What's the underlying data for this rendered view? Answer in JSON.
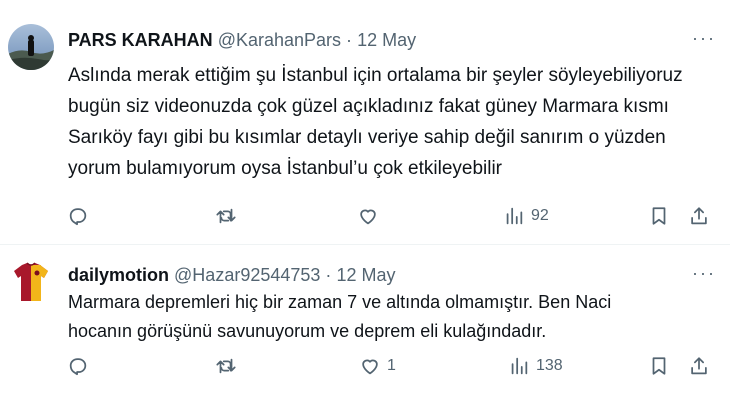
{
  "tweets": [
    {
      "name": "PARS KARAHAN",
      "handle": "@KarahanPars",
      "separator": "·",
      "date": "12 May",
      "more": "···",
      "lines": [
        "Aslında merak  ettiğim şu  İstanbul için ortalama bir şeyler söyleyebiliyoruz",
        "bugün siz videonuzda çok güzel açıkladınız fakat güney Marmara kısmı",
        "Sarıköy fayı gibi bu kısımlar detaylı veriye sahip değil sanırım o yüzden",
        "yorum bulamıyorum oysa İstanbul’u çok etkileyebilir"
      ],
      "actions": {
        "reply_count": "",
        "retweet_count": "",
        "like_count": "",
        "views_count": "92"
      },
      "avatar_colors": {
        "sky": "#6f8fb8",
        "ground": "#2f3a33",
        "figure": "#111111"
      }
    },
    {
      "name": "dailymotion",
      "handle": "@Hazar92544753",
      "separator": "·",
      "date": "12 May",
      "more": "···",
      "lines": [
        "Marmara depremleri hiç bir zaman 7 ve altında olmamıştır. Ben Naci",
        "hocanın görüşünü savunuyorum ve deprem eli kulağındadır."
      ],
      "actions": {
        "reply_count": "",
        "retweet_count": "",
        "like_count": "1",
        "views_count": "138"
      },
      "avatar_colors": {
        "jersey_red": "#a8182b",
        "jersey_yellow": "#f2b51a"
      }
    }
  ]
}
